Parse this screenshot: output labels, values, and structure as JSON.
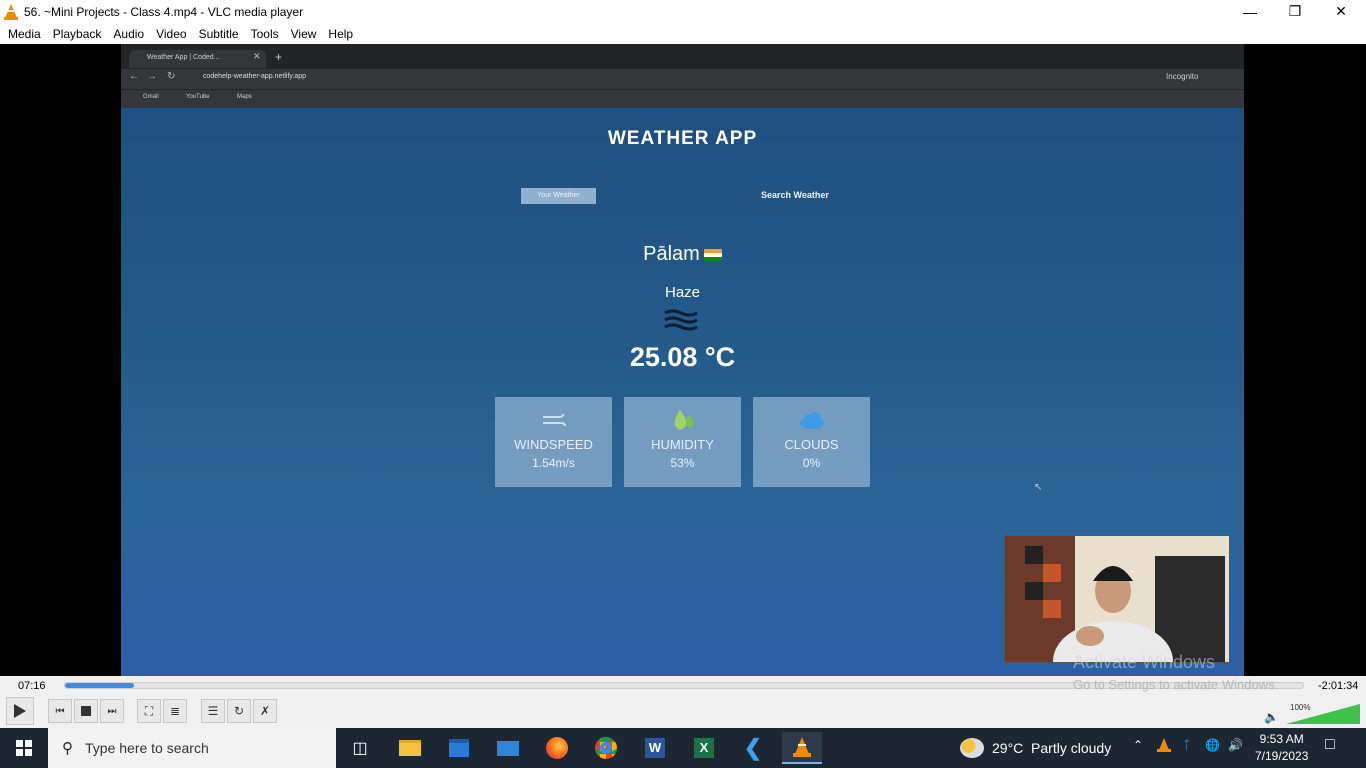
{
  "window": {
    "title": "56. ~Mini Projects - Class 4.mp4 - VLC media player"
  },
  "menu": [
    "Media",
    "Playback",
    "Audio",
    "Video",
    "Subtitle",
    "Tools",
    "View",
    "Help"
  ],
  "browser": {
    "tab_title": "Weather App | Coded...",
    "url": "codehelp-weather-app.netlify.app",
    "profile": "Incognito",
    "bookmarks": [
      "Gmail",
      "YouTube",
      "Maps"
    ]
  },
  "app": {
    "title": "WEATHER APP",
    "tab_your": "Your Weather",
    "tab_search": "Search Weather",
    "city": "Pālam",
    "description": "Haze",
    "temperature": "25.08 °C",
    "cards": [
      {
        "label": "WINDSPEED",
        "value": "1.54m/s"
      },
      {
        "label": "HUMIDITY",
        "value": "53%"
      },
      {
        "label": "CLOUDS",
        "value": "0%"
      }
    ]
  },
  "player": {
    "elapsed": "07:16",
    "remaining": "-2:01:34",
    "progress_fraction": 0.056,
    "volume": "100%",
    "volume_fraction": 1.0
  },
  "watermark": {
    "line1": "Activate Windows",
    "line2": "Go to Settings to activate Windows."
  },
  "taskbar": {
    "search_placeholder": "Type here to search",
    "weather": "29°C  Partly cloudy",
    "time": "9:53 AM",
    "date": "7/19/2023"
  },
  "colors": {
    "seek_fill": "#3b8ee8",
    "site_bg": "#245a8a",
    "taskbar_bg": "#1d2733"
  }
}
